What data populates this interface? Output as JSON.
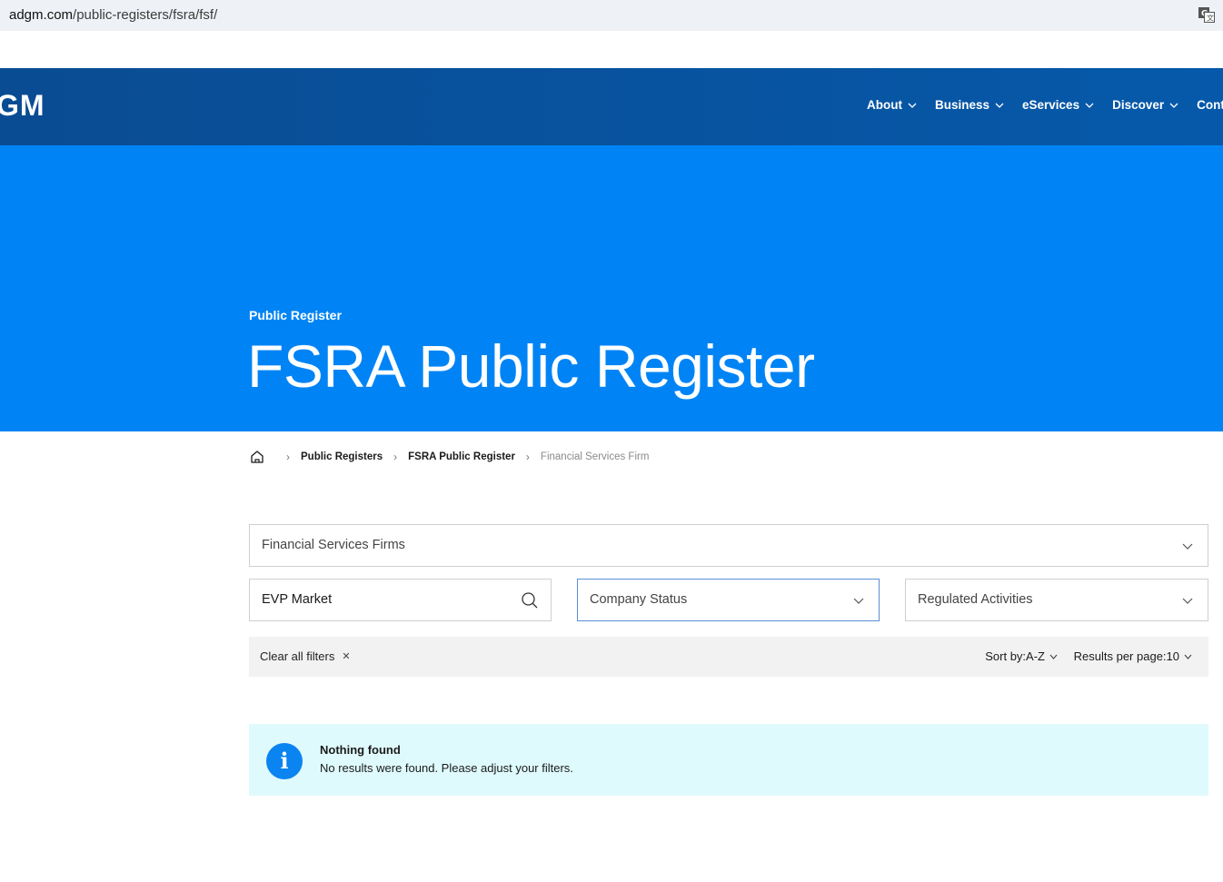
{
  "browser": {
    "url_host": "adgm.com",
    "url_path": "/public-registers/fsra/fsf/"
  },
  "header": {
    "logo_text": "GM",
    "nav": [
      {
        "label": "About"
      },
      {
        "label": "Business"
      },
      {
        "label": "eServices"
      },
      {
        "label": "Discover"
      },
      {
        "label": "Contac"
      }
    ]
  },
  "hero": {
    "eyebrow": "Public Register",
    "title": "FSRA Public Register"
  },
  "breadcrumb": {
    "items": [
      "Public Registers",
      "FSRA Public Register"
    ],
    "current": "Financial Services Firm"
  },
  "filters": {
    "register_type": "Financial Services Firms",
    "search_value": "EVP Market",
    "company_status_placeholder": "Company Status",
    "regulated_activities_placeholder": "Regulated Activities",
    "clear_all": "Clear all filters",
    "sort_label": "Sort by:A-Z",
    "per_page_label": "Results per page:10"
  },
  "alert": {
    "title": "Nothing found",
    "message": "No results were found. Please adjust your filters."
  },
  "colors": {
    "header_bg": "#0659aa",
    "hero_bg": "#0084f5",
    "alert_bg": "#dffafd",
    "info_icon": "#0a84f0"
  }
}
